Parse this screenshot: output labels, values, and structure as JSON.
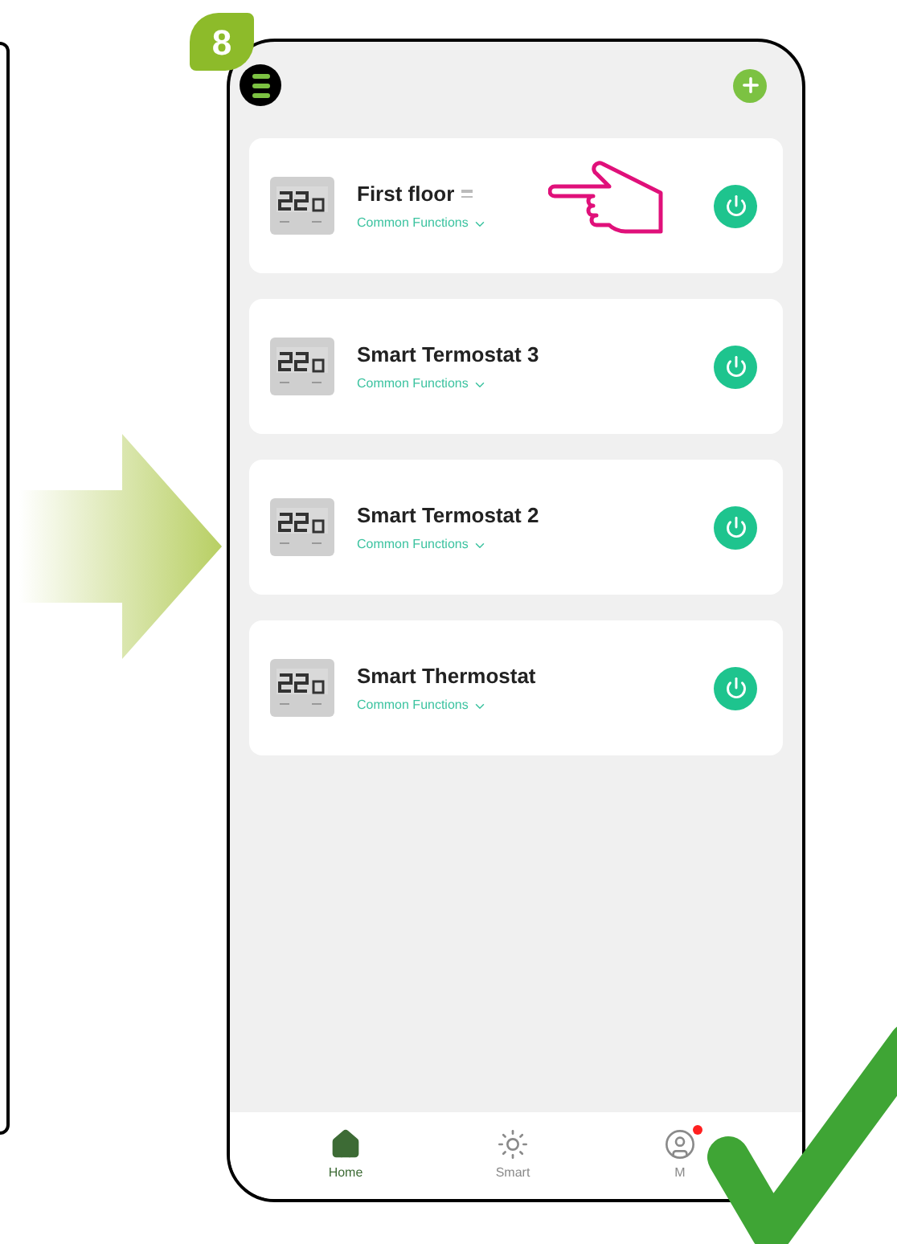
{
  "step_badge": "8",
  "devices": [
    {
      "name": "First floor",
      "subtitle": "Common Functions",
      "handle": true,
      "pointed": true,
      "on": true
    },
    {
      "name": "Smart Termostat 3",
      "subtitle": "Common Functions",
      "handle": false,
      "pointed": false,
      "on": true
    },
    {
      "name": "Smart Termostat 2",
      "subtitle": "Common Functions",
      "handle": false,
      "pointed": false,
      "on": true
    },
    {
      "name": "Smart Thermostat",
      "subtitle": "Common Functions",
      "handle": false,
      "pointed": false,
      "on": true
    }
  ],
  "nav": [
    {
      "kind": "home",
      "label": "Home",
      "selected": true,
      "badge": false
    },
    {
      "kind": "smart",
      "label": "Smart",
      "selected": false,
      "badge": false
    },
    {
      "kind": "me",
      "label": "M",
      "selected": false,
      "badge": true
    }
  ]
}
